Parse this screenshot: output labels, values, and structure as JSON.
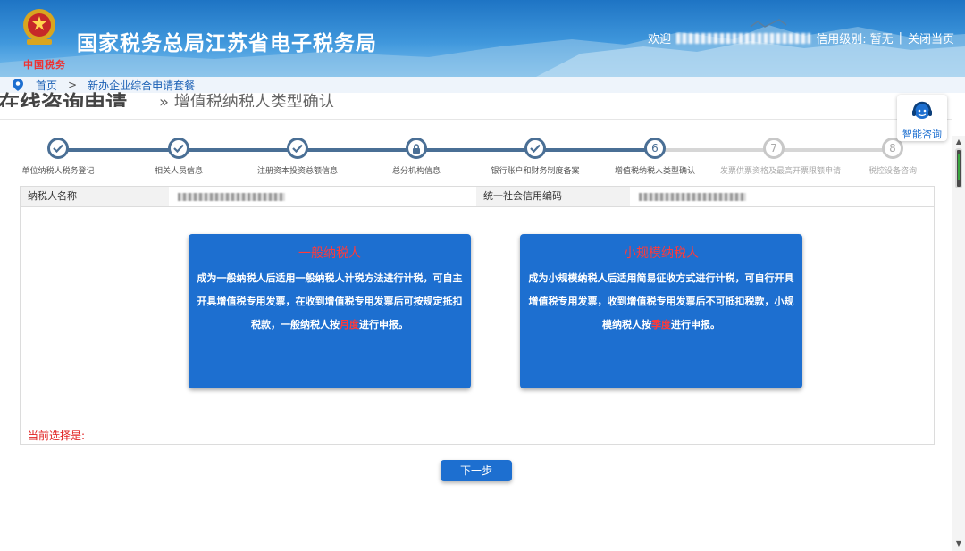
{
  "header": {
    "title": "国家税务总局江苏省电子税务局",
    "emblem_script": "中国税务",
    "welcome": "欢迎",
    "credit_label": "信用级别:",
    "credit_value": "暂无",
    "separator": "|",
    "close_page": "关闭当页"
  },
  "breadcrumb": {
    "home": "首页",
    "separator": ">",
    "current": "新办企业综合申请套餐"
  },
  "page": {
    "heading": "在线咨询申请",
    "subheading": "» 增值税纳税人类型确认"
  },
  "steps": [
    {
      "label": "单位纳税人税务登记",
      "status": "done",
      "icon": "check-icon"
    },
    {
      "label": "相关人员信息",
      "status": "done",
      "icon": "check-icon"
    },
    {
      "label": "注册资本投资总额信息",
      "status": "done",
      "icon": "check-icon"
    },
    {
      "label": "总分机构信息",
      "status": "locked",
      "icon": "lock-icon"
    },
    {
      "label": "银行账户和财务制度备案",
      "status": "done",
      "icon": "check-icon"
    },
    {
      "label": "增值税纳税人类型确认",
      "status": "current",
      "number": "6"
    },
    {
      "label": "发票供票资格及最高开票限额申请",
      "status": "pending",
      "number": "7"
    },
    {
      "label": "税控设备咨询",
      "status": "pending",
      "number": "8"
    }
  ],
  "info": {
    "taxpayer_name_label": "纳税人名称",
    "credit_code_label": "统一社会信用编码"
  },
  "cards": [
    {
      "title": "一般纳税人",
      "desc_before": "成为一般纳税人后适用一般纳税人计税方法进行计税，可自主开具增值税专用发票，在收到增值税专用发票后可按规定抵扣税款，一般纳税人按",
      "highlight": "月度",
      "desc_after": "进行申报。"
    },
    {
      "title": "小规模纳税人",
      "desc_before": "成为小规模纳税人后适用简易征收方式进行计税，可自行开具增值税专用发票，收到增值税专用发票后不可抵扣税款，小规模纳税人按",
      "highlight": "季度",
      "desc_after": "进行申报。"
    }
  ],
  "current_selection": "当前选择是:",
  "next_button": "下一步",
  "consult": {
    "label": "智能咨询"
  },
  "colors": {
    "primary": "#1d6fd0",
    "highlight": "#ff3a3a",
    "step_done": "#4a6f95",
    "step_pending": "#c8c8c8"
  }
}
